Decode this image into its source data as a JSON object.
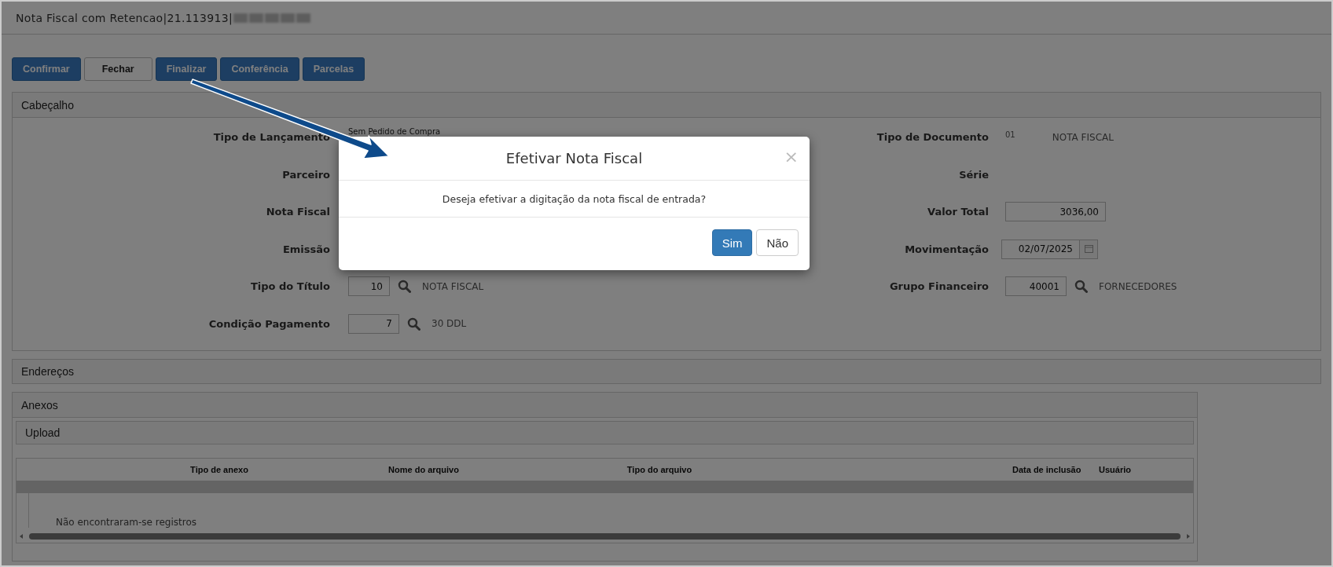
{
  "window": {
    "title": "Nota Fiscal com Retencao|21.113913|"
  },
  "toolbar": [
    {
      "label": "Confirmar",
      "kind": "primary"
    },
    {
      "label": "Fechar",
      "kind": "default"
    },
    {
      "label": "Finalizar",
      "kind": "primary"
    },
    {
      "label": "Conferência",
      "kind": "primary"
    },
    {
      "label": "Parcelas",
      "kind": "primary"
    }
  ],
  "header": {
    "title": "Cabeçalho",
    "left_fields": [
      {
        "label": "Tipo de Lançamento",
        "kind": "text",
        "description": "Sem Pedido de Compra"
      },
      {
        "label": "Parceiro",
        "kind": "label"
      },
      {
        "label": "Nota Fiscal",
        "kind": "label"
      },
      {
        "label": "Emissão",
        "kind": "label"
      },
      {
        "label": "Tipo do Título",
        "kind": "lookup",
        "value": "10",
        "description": "NOTA FISCAL"
      },
      {
        "label": "Condição Pagamento",
        "kind": "lookup",
        "value": "7",
        "description": "30 DDL"
      }
    ],
    "right_fields": [
      {
        "label": "Tipo de Documento",
        "kind": "text",
        "code": "01",
        "description": "NOTA FISCAL"
      },
      {
        "label": "Série",
        "kind": "label"
      },
      {
        "label": "Valor Total",
        "kind": "input",
        "value": "3036,00"
      },
      {
        "label": "Movimentação",
        "kind": "date",
        "value": "02/07/2025"
      },
      {
        "label": "Grupo Financeiro",
        "kind": "lookup",
        "value": "40001",
        "description": "FORNECEDORES"
      }
    ]
  },
  "addresses": {
    "title": "Endereços"
  },
  "attachments": {
    "title": "Anexos",
    "upload": {
      "title": "Upload"
    },
    "table": {
      "columns": [
        "Tipo de anexo",
        "Nome do arquivo",
        "Tipo do arquivo",
        "Data de inclusão",
        "Usuário"
      ],
      "empty_message": "Não encontraram-se registros"
    }
  },
  "modal": {
    "title": "Efetivar Nota Fiscal",
    "close": "×",
    "message": "Deseja efetivar a digitação da nota fiscal de entrada?",
    "buttons": [
      {
        "label": "Sim",
        "kind": "primary"
      },
      {
        "label": "Não",
        "kind": "default"
      }
    ]
  }
}
